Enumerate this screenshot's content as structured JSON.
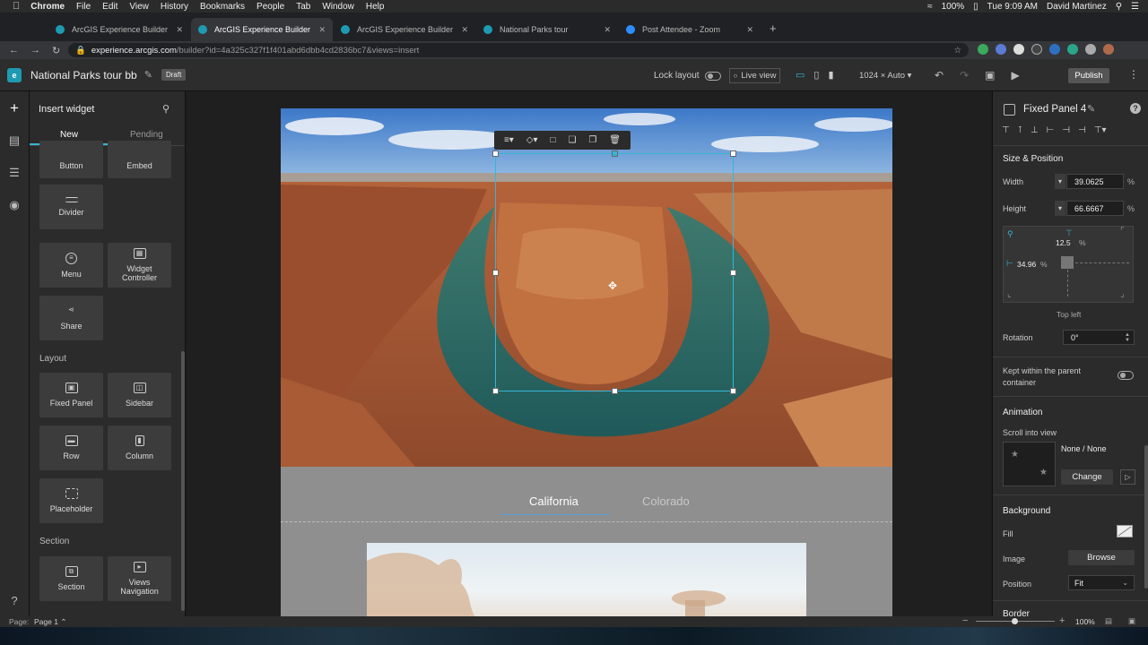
{
  "macos_menubar": {
    "app": "Chrome",
    "menus": [
      "File",
      "Edit",
      "View",
      "History",
      "Bookmarks",
      "People",
      "Tab",
      "Window",
      "Help"
    ],
    "battery": "100%",
    "clock": "Tue 9:09 AM",
    "user": "David Martinez"
  },
  "browser": {
    "tabs": [
      {
        "title": "ArcGIS Experience Builder",
        "active": false
      },
      {
        "title": "ArcGIS Experience Builder",
        "active": true
      },
      {
        "title": "ArcGIS Experience Builder",
        "active": false
      },
      {
        "title": "National Parks tour",
        "active": false
      },
      {
        "title": "Post Attendee - Zoom",
        "active": false
      }
    ],
    "url_host": "experience.arcgis.com",
    "url_path": "/builder?id=4a325c327f1f401abd6dbb4cd2836bc7&views=insert"
  },
  "app_header": {
    "title": "National Parks tour bb",
    "badge": "Draft",
    "lock_layout_label": "Lock layout",
    "live_view_label": "Live view",
    "resolution": "1024 × Auto",
    "publish_label": "Publish"
  },
  "insert_panel": {
    "title": "Insert widget",
    "tabs": [
      "New",
      "Pending"
    ],
    "widgets_top": [
      "Button",
      "Embed",
      "Divider",
      "Menu",
      "Widget Controller",
      "Share"
    ],
    "layout_heading": "Layout",
    "layout_widgets": [
      "Fixed Panel",
      "Sidebar",
      "Row",
      "Column",
      "Placeholder"
    ],
    "section_heading": "Section",
    "section_widgets": [
      "Section",
      "Views Navigation"
    ]
  },
  "canvas": {
    "nav_tabs": [
      "California",
      "Colorado"
    ],
    "active_nav_tab": "California"
  },
  "right_panel": {
    "title": "Fixed Panel 4",
    "size_position_heading": "Size & Position",
    "width_label": "Width",
    "width_value": "39.0625",
    "width_unit": "%",
    "height_label": "Height",
    "height_value": "66.6667",
    "height_unit": "%",
    "top_value": "12.5",
    "top_unit": "%",
    "left_value": "34.96",
    "left_unit": "%",
    "anchor_label": "Top left",
    "rotation_label": "Rotation",
    "rotation_value": "0°",
    "kept_within_label": "Kept within the parent container",
    "animation_heading": "Animation",
    "scroll_into_view_label": "Scroll into view",
    "animation_value": "None / None",
    "change_label": "Change",
    "background_heading": "Background",
    "fill_label": "Fill",
    "image_label": "Image",
    "browse_label": "Browse",
    "position_label": "Position",
    "position_value": "Fit",
    "border_heading": "Border"
  },
  "status_bar": {
    "page_label": "Page:",
    "page_value": "Page 1",
    "zoom": "100%"
  },
  "colors": {
    "accent": "#35b6d6",
    "panel_bg": "#2b2b2b",
    "canvas_bg": "#1f1f1f"
  }
}
